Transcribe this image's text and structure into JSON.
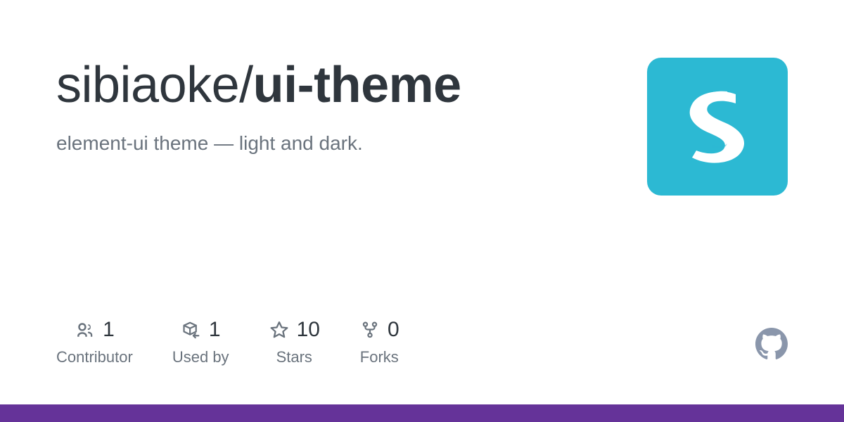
{
  "repository": {
    "owner": "sibiaoke/",
    "name": "ui-theme",
    "full_name": "sibiaoke/ui-theme",
    "description": "element-ui theme — light and dark."
  },
  "avatar": {
    "icon": "brush-stroke-s-logo",
    "background_color": "#2cb9d3",
    "mark_color": "#ffffff",
    "alt": "sibiaoke avatar"
  },
  "stats": [
    {
      "icon": "people-icon",
      "count": "1",
      "label": "Contributor"
    },
    {
      "icon": "package-dependents-icon",
      "count": "1",
      "label": "Used by"
    },
    {
      "icon": "star-icon",
      "count": "10",
      "label": "Stars"
    },
    {
      "icon": "repo-forked-icon",
      "count": "0",
      "label": "Forks"
    }
  ],
  "branding": {
    "mark": "github-octocat-icon",
    "mark_color": "#8a96ab",
    "bottom_bar_color": "#653399"
  },
  "colors": {
    "background": "#ffffff",
    "title": "#2f363d",
    "description": "#6a737d",
    "stat_count": "#2f363d",
    "stat_label": "#6a737d",
    "accent_teal": "#2cb9d3",
    "accent_purple": "#653399"
  }
}
